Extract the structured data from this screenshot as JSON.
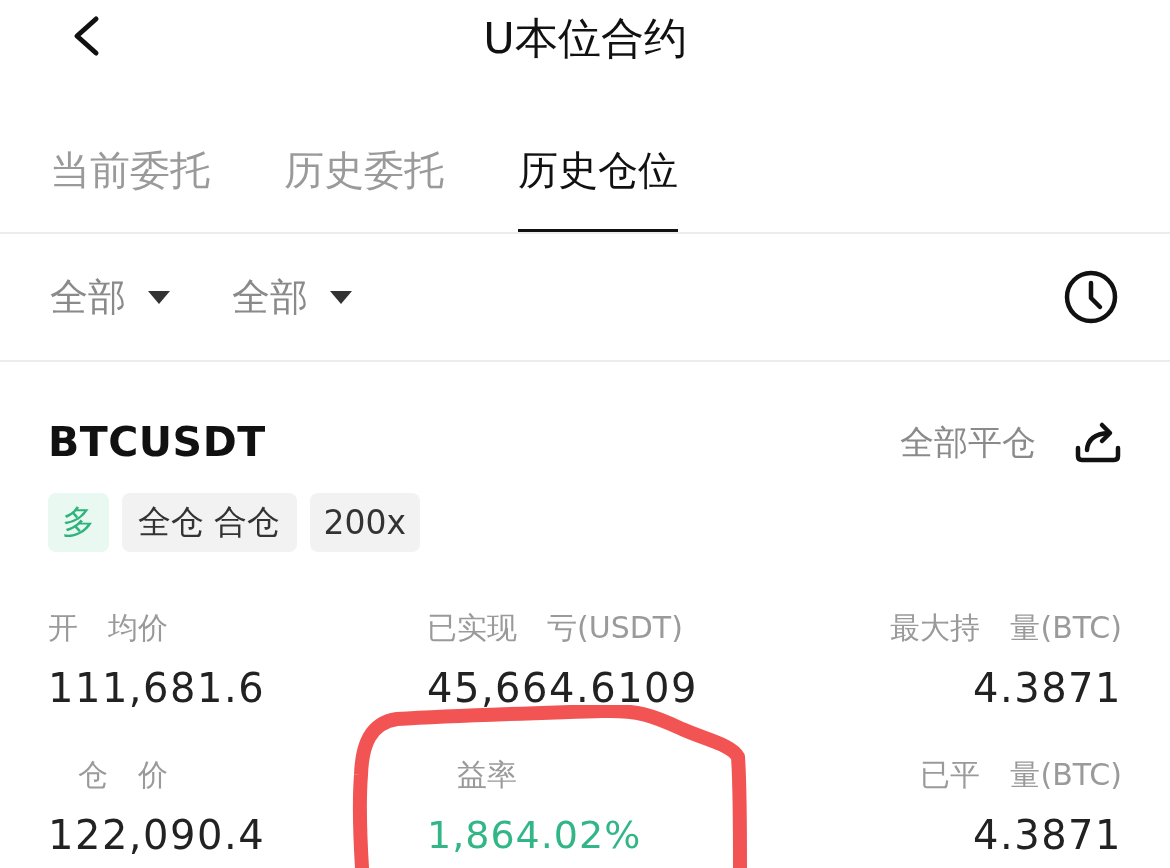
{
  "header": {
    "title": "U本位合约"
  },
  "tabs": [
    {
      "label": "当前委托",
      "selected": false
    },
    {
      "label": "历史委托",
      "selected": false
    },
    {
      "label": "历史仓位",
      "selected": true
    }
  ],
  "filters": [
    {
      "label": "全部"
    },
    {
      "label": "全部"
    }
  ],
  "position": {
    "symbol": "BTCUSDT",
    "close_all": "全部平仓",
    "tags": [
      {
        "label": "多",
        "kind": "side"
      },
      {
        "label": "全仓 合仓",
        "kind": "mode"
      },
      {
        "label": "200x",
        "kind": "leverage"
      }
    ],
    "metrics": [
      {
        "label": "开　均价",
        "value": "111,681.6",
        "kind": "plain",
        "circled": false
      },
      {
        "label": "已实现　亏(USDT)",
        "value": "45,664.6109",
        "kind": "plain",
        "circled": false
      },
      {
        "label": "最大持　量(BTC)",
        "value": "4.3871",
        "kind": "plain",
        "circled": false
      },
      {
        "label": "　仓　价",
        "value": "122,090.4",
        "kind": "plain",
        "circled": false
      },
      {
        "label": "　益率",
        "value": "1,864.02%",
        "kind": "gain",
        "circled": true
      },
      {
        "label": "已平　量(BTC)",
        "value": "4.3871",
        "kind": "plain",
        "circled": false
      }
    ]
  }
}
